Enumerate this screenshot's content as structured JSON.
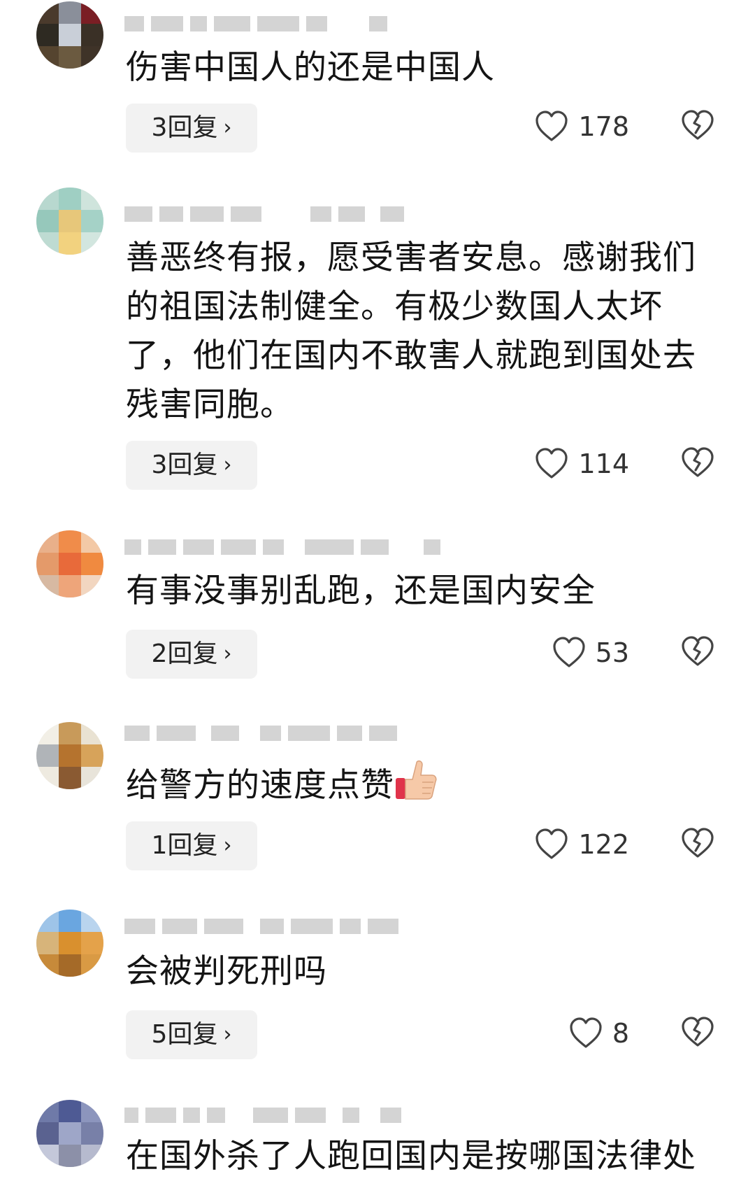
{
  "comments": [
    {
      "text": "伤害中国人的还是中国人",
      "replies_label": "3回复",
      "likes": "178"
    },
    {
      "text": "善恶终有报，愿受害者安息。感谢我们的祖国法制健全。有极少数国人太坏了，他们在国内不敢害人就跑到国处去残害同胞。",
      "replies_label": "3回复",
      "likes": "114"
    },
    {
      "text": "有事没事别乱跑，还是国内安全",
      "replies_label": "2回复",
      "likes": "53"
    },
    {
      "text": "给警方的速度点赞",
      "emoji": "thumbs-up",
      "replies_label": "1回复",
      "likes": "122"
    },
    {
      "text": "会被判死刑吗",
      "replies_label": "5回复",
      "likes": "8"
    },
    {
      "text": "在国外杀了人跑回国内是按哪国法律处"
    }
  ],
  "icons": {
    "like": "heart-outline-icon",
    "dislike": "broken-heart-icon",
    "reply_chevron": "chevron-right-icon"
  },
  "colors": {
    "reply_button_bg": "#f2f2f2",
    "text": "#141414",
    "icon_stroke": "#444444",
    "blur_placeholder": "#d4d4d4"
  }
}
